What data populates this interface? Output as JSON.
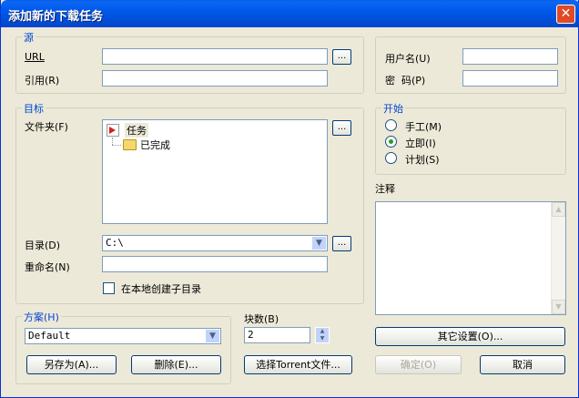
{
  "window": {
    "title": "添加新的下载任务",
    "close_glyph": "✕"
  },
  "source": {
    "legend": "源",
    "url_label": "URL",
    "url_value": "",
    "url_browse": "...",
    "ref_label": "引用(R)",
    "ref_value": ""
  },
  "auth": {
    "user_label": "用户名(U)",
    "user_value": "",
    "pass_label": "密  码(P)",
    "pass_value": ""
  },
  "target": {
    "legend": "目标",
    "folder_label": "文件夹(F)",
    "folder_browse": "...",
    "tree": [
      {
        "label": "任务",
        "icon": "task-folder-icon"
      },
      {
        "label": "已完成",
        "icon": "completed-folder-icon"
      }
    ],
    "dir_label": "目录(D)",
    "dir_value": "C:\\",
    "dir_browse": "...",
    "rename_label": "重命名(N)",
    "rename_value": "",
    "subdir_label": "在本地创建子目录",
    "subdir_checked": false
  },
  "start": {
    "legend": "开始",
    "options": [
      {
        "label": "手工(M)",
        "selected": false
      },
      {
        "label": "立即(I)",
        "selected": true
      },
      {
        "label": "计划(S)",
        "selected": false
      }
    ]
  },
  "notes": {
    "label": "注释",
    "value": ""
  },
  "scheme": {
    "legend": "方案(H)",
    "selected": "Default",
    "save_as": "另存为(A)...",
    "delete": "删除(E)..."
  },
  "blocks": {
    "label": "块数(B)",
    "value": "2",
    "torrent_button": "选择Torrent文件..."
  },
  "footer": {
    "other_settings": "其它设置(O)...",
    "ok": "确定(O)",
    "cancel": "取消"
  },
  "colors": {
    "accent": "#0046d5",
    "title_bar": "#0058e8",
    "selected_radio": "#21a121"
  }
}
